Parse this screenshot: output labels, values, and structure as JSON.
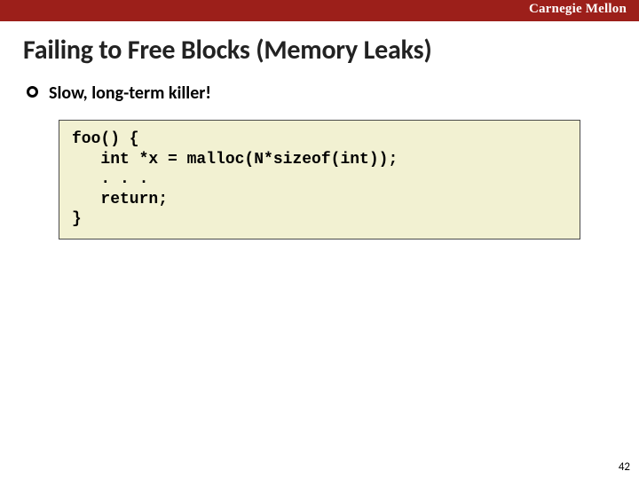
{
  "header": {
    "brand": "Carnegie Mellon"
  },
  "slide": {
    "title": "Failing to Free Blocks (Memory Leaks)",
    "bullet": "Slow, long-term killer!",
    "code": "foo() {\n   int *x = malloc(N*sizeof(int));\n   . . .\n   return;\n}",
    "page_number": "42"
  }
}
